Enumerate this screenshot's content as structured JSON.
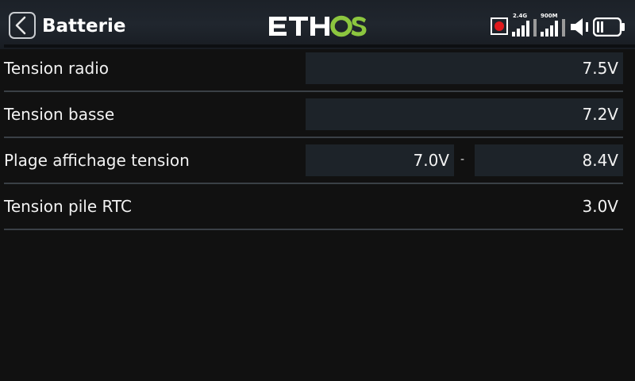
{
  "header": {
    "title": "Batterie",
    "logo_text": "ETHOS",
    "logo_colors": {
      "primary": "#ffffff",
      "accent": "#8cc63f"
    },
    "status": {
      "band_1_label": "2.4G",
      "band_2_label": "900M",
      "record_color": "#e0191d"
    }
  },
  "settings": [
    {
      "label": "Tension radio",
      "value": "7.5V"
    },
    {
      "label": "Tension basse",
      "value": "7.2V"
    },
    {
      "label": "Plage affichage tension",
      "min": "7.0V",
      "separator": "-",
      "max": "8.4V"
    },
    {
      "label": "Tension pile RTC",
      "value": "3.0V"
    }
  ]
}
